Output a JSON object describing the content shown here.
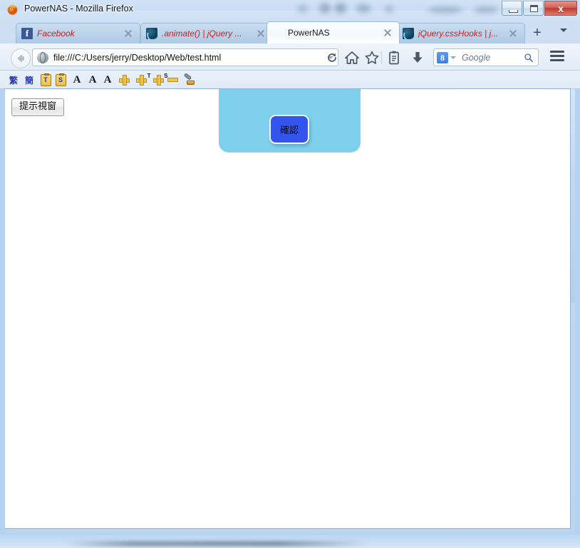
{
  "window": {
    "title": "PowerNAS - Mozilla Firefox",
    "controls": {
      "minimize_label": "–",
      "maximize_label": "□",
      "close_label": "x"
    }
  },
  "tabs": {
    "items": [
      {
        "label": "Facebook",
        "favicon": "facebook-icon",
        "active": false
      },
      {
        "label": ".animate() | jQuery ...",
        "favicon": "jquery-icon",
        "active": false
      },
      {
        "label": "PowerNAS",
        "favicon": "none",
        "active": true
      },
      {
        "label": "jQuery.cssHooks | j...",
        "favicon": "jquery-icon",
        "active": false
      }
    ],
    "new_tab_label": "+",
    "list_all_tabs_name": "chevron-down-icon"
  },
  "navbar": {
    "back_icon": "back-arrow-icon",
    "url": "file:///C:/Users/jerry/Desktop/Web/test.html",
    "url_favicon": "globe-icon",
    "url_dropdown_icon": "chevron-down-icon",
    "reload_icon": "reload-icon",
    "home_icon": "home-icon",
    "bookmark_icon": "star-icon",
    "sidebar_icon": "clipboard-icon",
    "downloads_icon": "download-arrow-icon",
    "search": {
      "engine_logo": "8",
      "placeholder": "Google",
      "go_icon": "magnifier-icon"
    },
    "menu_icon": "hamburger-menu-icon"
  },
  "addon_toolbar": {
    "items": [
      {
        "name": "traditional-chinese-button",
        "label": "繁"
      },
      {
        "name": "simplified-chinese-button",
        "label": "簡"
      },
      {
        "name": "copy-traditional-button",
        "label": "T"
      },
      {
        "name": "copy-simplified-button",
        "label": "S"
      },
      {
        "name": "font-increase-button",
        "label": "A"
      },
      {
        "name": "font-decrease-button",
        "label": "A"
      },
      {
        "name": "font-reset-button",
        "label": "A"
      },
      {
        "name": "add-word-button",
        "label": ""
      },
      {
        "name": "add-traditional-word-button",
        "label": "T"
      },
      {
        "name": "add-simplified-word-button",
        "label": "S"
      },
      {
        "name": "remove-word-button",
        "label": ""
      },
      {
        "name": "settings-wrench-button",
        "label": ""
      }
    ]
  },
  "page": {
    "hint_button_label": "提示視窗",
    "dialog": {
      "confirm_label": "確認",
      "panel_color": "#7fd0ec",
      "button_color": "#3355ee"
    }
  }
}
